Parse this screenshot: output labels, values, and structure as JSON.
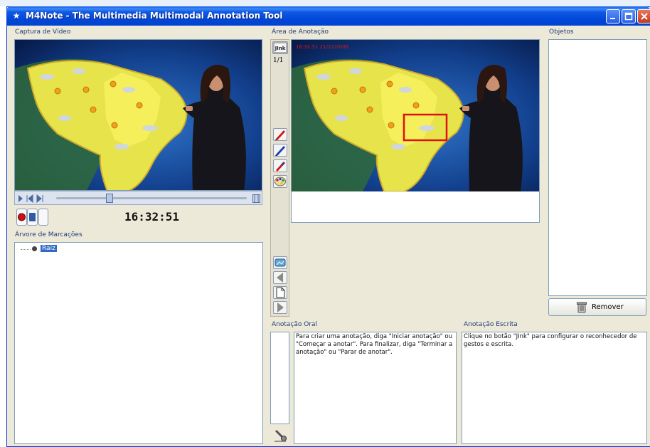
{
  "window": {
    "title": "M4Note - The Multimedia Multimodal Annotation Tool"
  },
  "video_capture": {
    "label": "Captura de Vídeo",
    "time": "16:32:51"
  },
  "markers_tree": {
    "label": "Árvore de Marcações",
    "root": "Raiz"
  },
  "annotation_area": {
    "label": "Área de Anotação",
    "page": "1/1",
    "timestamp": "16:32:51 21/12/2006",
    "jink_label": "JInk"
  },
  "objects": {
    "label": "Objetos",
    "remove_label": "Remover"
  },
  "oral_annotation": {
    "label": "Anotação Oral",
    "text": "Para criar uma anotação, diga \"Iniciar anotação\" ou \"Começar a anotar\". Para finalizar, diga \"Terminar a anotação\" ou \"Parar de anotar\"."
  },
  "written_annotation": {
    "label": "Anotação Escrita",
    "text": "Clique no botão \"JInk\" para configurar o reconhecedor de gestos e escrita."
  },
  "colors": {
    "titlebar": "#0046d8",
    "panel_border": "#7f9db9",
    "window_bg": "#ece9d8",
    "selection": "#316ac5",
    "annotation_rect": "#e01010"
  }
}
